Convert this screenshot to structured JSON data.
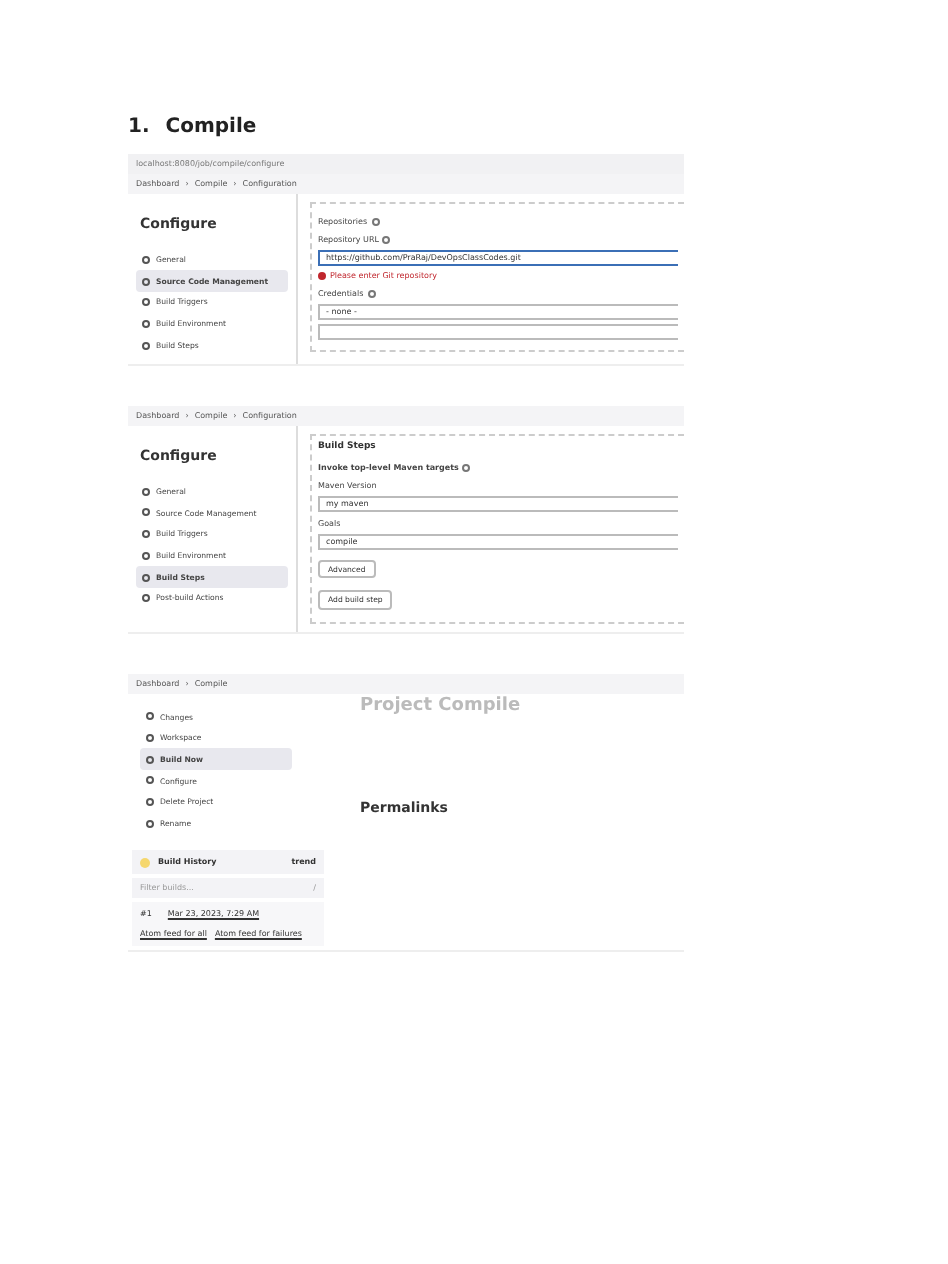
{
  "heading": {
    "number": "1.",
    "text": "Compile"
  },
  "screens": [
    {
      "kind": "config",
      "address": "localhost:8080/job/compile/configure",
      "separator": "›",
      "breadcrumbs": [
        "Dashboard",
        "Compile",
        "Configuration"
      ],
      "title": "Configure",
      "sidebar": [
        {
          "label": "General",
          "selected": false
        },
        {
          "label": "Source Code Management",
          "selected": true
        },
        {
          "label": "Build Triggers",
          "selected": false
        },
        {
          "label": "Build Environment",
          "selected": false
        },
        {
          "label": "Build Steps",
          "selected": false
        }
      ],
      "panel": [
        {
          "kind": "label",
          "text": "Repositories",
          "help": true
        },
        {
          "kind": "label",
          "text": "Repository URL",
          "help": true
        },
        {
          "kind": "input",
          "value": "https://github.com/PraRaj/DevOpsClassCodes.git",
          "focused": true
        },
        {
          "kind": "error",
          "text": "Please enter Git repository"
        },
        {
          "kind": "label",
          "text": "Credentials",
          "help": true
        },
        {
          "kind": "select",
          "value": "- none -"
        },
        {
          "kind": "input",
          "focused": false
        }
      ]
    },
    {
      "kind": "config",
      "separator": "›",
      "breadcrumbs": [
        "Dashboard",
        "Compile",
        "Configuration"
      ],
      "title": "Configure",
      "sidebar": [
        {
          "label": "General",
          "selected": false
        },
        {
          "label": "Source Code Management",
          "selected": false
        },
        {
          "label": "Build Triggers",
          "selected": false
        },
        {
          "label": "Build Environment",
          "selected": false
        },
        {
          "label": "Build Steps",
          "selected": true
        },
        {
          "label": "Post-build Actions",
          "selected": false
        }
      ],
      "panel": [
        {
          "kind": "heading",
          "text": "Build Steps"
        },
        {
          "kind": "step",
          "text": "Invoke top-level Maven targets",
          "help": true
        },
        {
          "kind": "label",
          "text": "Maven Version",
          "help": false
        },
        {
          "kind": "select",
          "value": "my maven"
        },
        {
          "kind": "label",
          "text": "Goals",
          "help": false
        },
        {
          "kind": "input",
          "value": "compile",
          "focused": false
        },
        {
          "kind": "button",
          "text": "Advanced"
        },
        {
          "kind": "button",
          "text": "Add build step"
        }
      ]
    },
    {
      "kind": "project",
      "separator": "›",
      "breadcrumbs": [
        "Dashboard",
        "Compile"
      ],
      "title": "Project Compile",
      "sidebar": [
        {
          "label": "Changes",
          "selected": false
        },
        {
          "label": "Workspace",
          "selected": false
        },
        {
          "label": "Build Now",
          "selected": true
        },
        {
          "label": "Configure",
          "selected": false
        },
        {
          "label": "Delete Project",
          "selected": false
        },
        {
          "label": "Rename",
          "selected": false
        }
      ],
      "history": {
        "title": "Build History",
        "trend": "trend",
        "placeholder": "Filter builds...",
        "shortcut": "/",
        "builds": [
          {
            "number": "#1",
            "date": "Mar 23, 2023, 7:29 AM"
          }
        ],
        "feeds": [
          "Atom feed for all",
          "Atom feed for failures"
        ]
      },
      "permalinks": "Permalinks"
    }
  ]
}
